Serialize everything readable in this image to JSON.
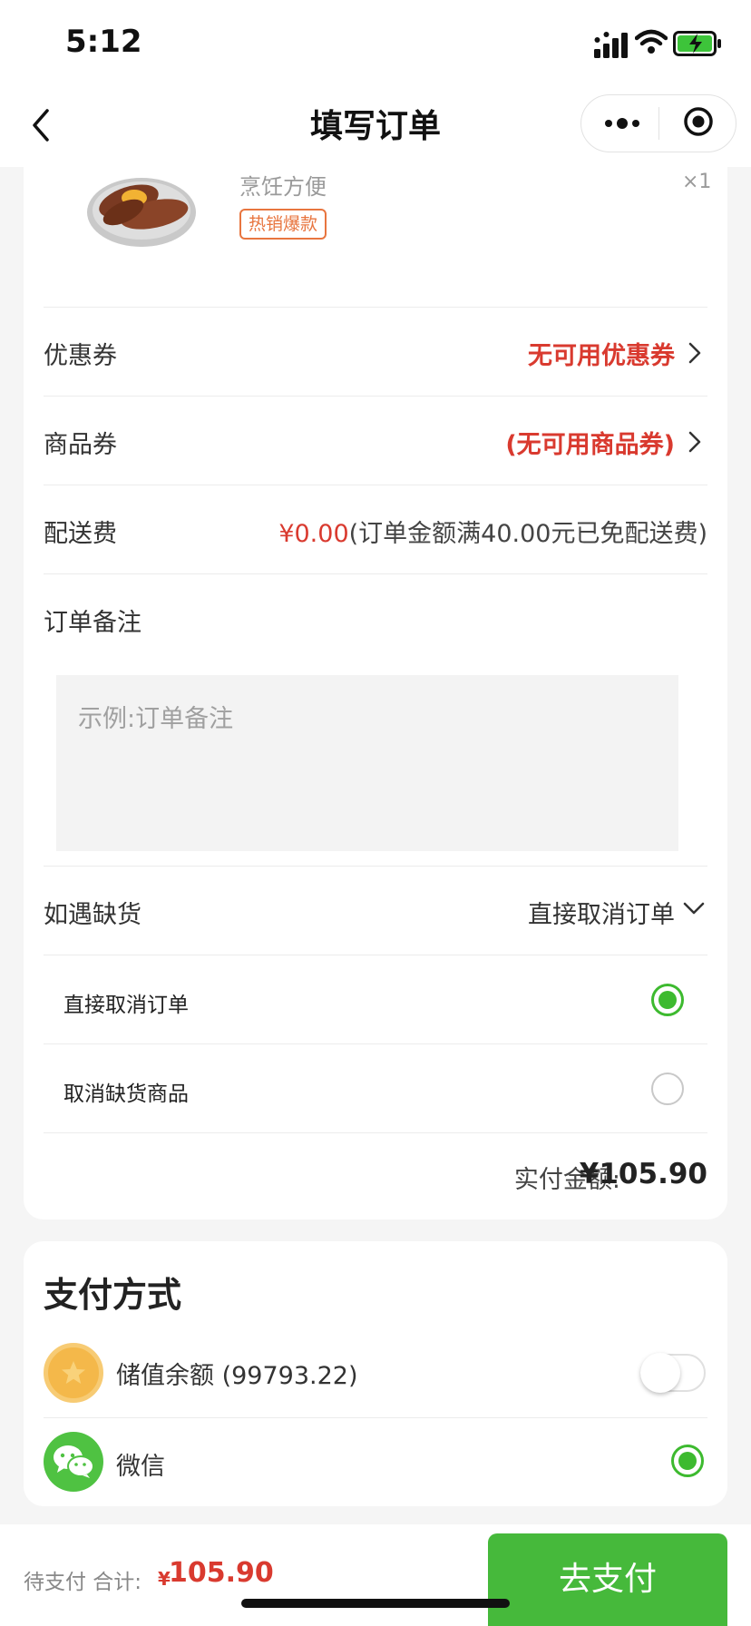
{
  "status_bar": {
    "time": "5:12"
  },
  "nav": {
    "title": "填写订单"
  },
  "product": {
    "subtitle": "烹饪方便",
    "quantity": "×1",
    "tag": "热销爆款"
  },
  "rows": {
    "coupon": {
      "label": "优惠券",
      "value": "无可用优惠券"
    },
    "voucher": {
      "label": "商品券",
      "value": "(无可用商品券)"
    },
    "delivery": {
      "label": "配送费",
      "fee": "¥0.00",
      "note": "(订单金额满40.00元已免配送费)"
    },
    "remark": {
      "label": "订单备注",
      "placeholder": "示例:订单备注"
    },
    "stockout": {
      "label": "如遇缺货",
      "selected": "直接取消订单"
    }
  },
  "stockout_options": [
    {
      "label": "直接取消订单",
      "selected": true
    },
    {
      "label": "取消缺货商品",
      "selected": false
    }
  ],
  "total": {
    "label": "实付金额:",
    "amount": "¥105.90"
  },
  "payment": {
    "title": "支付方式",
    "methods": [
      {
        "label": "储值余额 (99793.22)",
        "enabled": false
      },
      {
        "label": "微信",
        "selected": true
      }
    ]
  },
  "bottom": {
    "label": "待支付 合计:",
    "currency": "¥",
    "amount": "105.90",
    "button": "去支付"
  },
  "colors": {
    "accent_green": "#46b93b",
    "price_red": "#d93a2f",
    "tag_orange": "#e8753f"
  }
}
